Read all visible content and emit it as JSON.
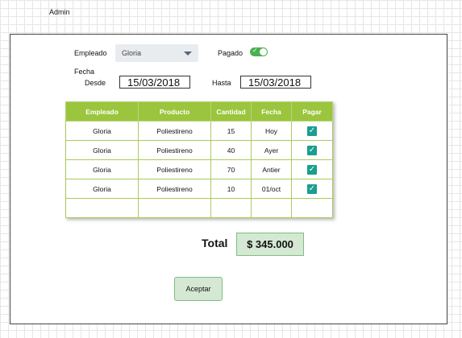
{
  "header": {
    "user_label": "Admin"
  },
  "form": {
    "empleado_label": "Empleado",
    "empleado_value": "Gloria",
    "pagado_label": "Pagado",
    "pagado_on": true,
    "fecha_label": "Fecha",
    "desde_label": "Desde",
    "desde_value": "15/03/2018",
    "hasta_label": "Hasta",
    "hasta_value": "15/03/2018"
  },
  "table": {
    "columns": [
      "Empleado",
      "Producto",
      "Cantidad",
      "Fecha",
      "Pagar"
    ],
    "rows": [
      {
        "empleado": "Gloria",
        "producto": "Poliestireno",
        "cantidad": "15",
        "fecha": "Hoy",
        "pagar": true
      },
      {
        "empleado": "Gloria",
        "producto": "Poliestireno",
        "cantidad": "40",
        "fecha": "Ayer",
        "pagar": true
      },
      {
        "empleado": "Gloria",
        "producto": "Poliestireno",
        "cantidad": "70",
        "fecha": "Antier",
        "pagar": true
      },
      {
        "empleado": "Gloria",
        "producto": "Poliestireno",
        "cantidad": "10",
        "fecha": "01/oct",
        "pagar": true
      }
    ],
    "check_icon": "checkbox-checked-icon"
  },
  "summary": {
    "total_label": "Total",
    "total_value": "$ 345.000"
  },
  "actions": {
    "accept_label": "Aceptar"
  },
  "colors": {
    "header_green": "#9bc53d",
    "toggle_green": "#4caf50",
    "checkbox_teal": "#1a9e8f",
    "button_green": "#d4e8d4"
  }
}
